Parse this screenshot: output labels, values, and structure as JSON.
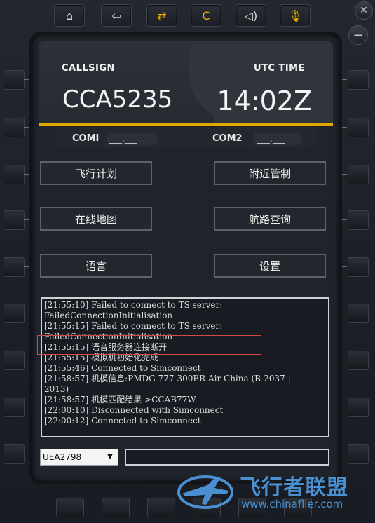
{
  "top_buttons": [
    {
      "icon": "home-icon",
      "glyph": "⌂"
    },
    {
      "icon": "back-icon",
      "glyph": "⇦"
    },
    {
      "icon": "swap-icon",
      "glyph": "⇄"
    },
    {
      "icon": "c-icon",
      "glyph": "C"
    },
    {
      "icon": "speaker-icon",
      "glyph": "◁)"
    },
    {
      "icon": "microphone-icon",
      "glyph": "🎙"
    }
  ],
  "corner_close": "✕",
  "corner_minimize": "−",
  "header": {
    "callsign_label": "CALLSIGN",
    "callsign_value": "CCA5235",
    "utc_label": "UTC TIME",
    "utc_value": "14:02Z"
  },
  "com": {
    "com1_label": "COMI",
    "com1_value": "___.___",
    "com2_label": "COM2",
    "com2_value": "___.___"
  },
  "menu": {
    "flight_plan": "飞行计划",
    "nearby_atc": "附近管制",
    "online_map": "在线地图",
    "route_query": "航路查询",
    "language": "语言",
    "settings": "设置"
  },
  "console_lines": [
    "[21:55:10] Failed to connect to TS server:",
    "FailedConnectionInitialisation",
    "[21:55:15] Failed to connect to TS server:",
    "FailedConnectionInitialisation",
    "[21:55:15] 语音服务器连接断开",
    "[21:55:15] 模拟机初始化完成",
    "[21:55:46] Connected to Simconnect",
    "[21:58:57] 机模信息:PMDG 777-300ER Air China (B-2037 |",
    "2013)",
    "[21:58:57] 机模匹配结果->CCAB77W",
    "[22:00:10] Disconnected with Simconnect",
    "[22:00:12] Connected to Simconnect"
  ],
  "bottom": {
    "select_value": "UEA2798",
    "select_arrow": "▼",
    "input_value": ""
  },
  "watermark": {
    "text": "飞行者联盟",
    "url": "www.chinaflier.com"
  },
  "colors": {
    "accent": "#e0a800",
    "watermark": "#4a8fd0",
    "highlight": "#d24a4a"
  }
}
